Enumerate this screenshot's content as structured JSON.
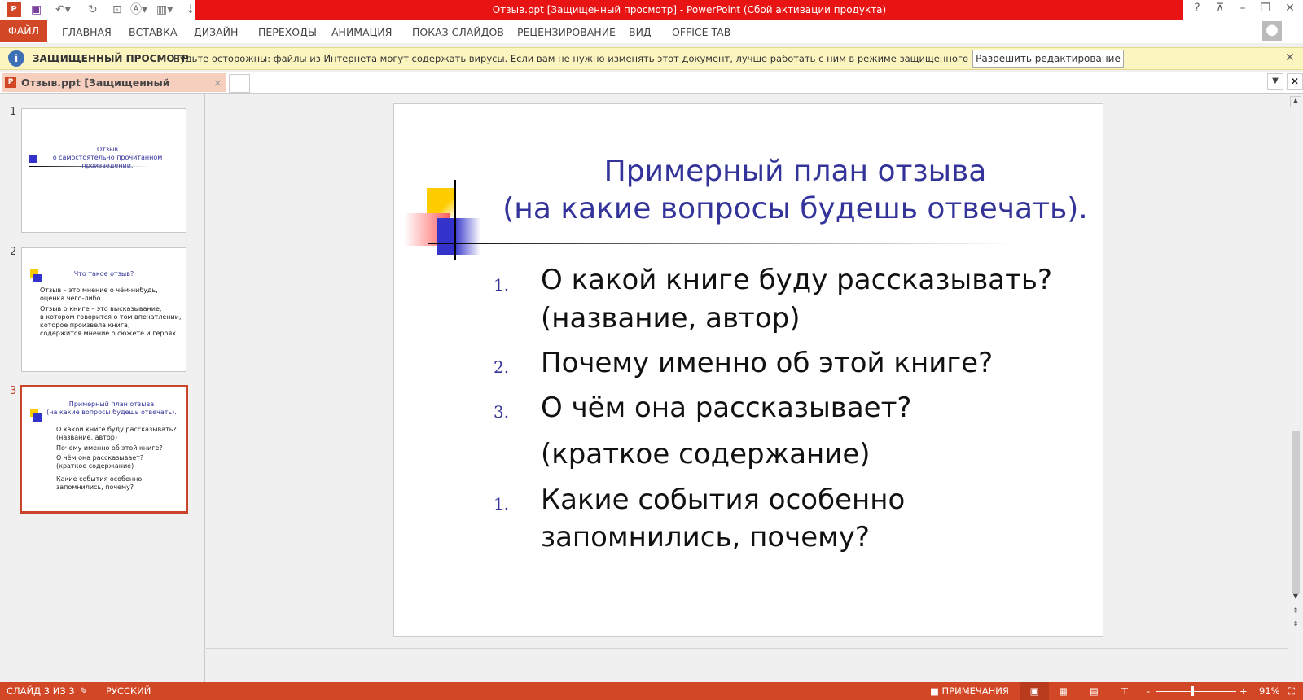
{
  "window": {
    "title": "Отзыв.ppt [Защищенный просмотр] -  PowerPoint (Сбой активации продукта)"
  },
  "ribbon": {
    "tabs": [
      "ФАЙЛ",
      "ГЛАВНАЯ",
      "ВСТАВКА",
      "ДИЗАЙН",
      "ПЕРЕХОДЫ",
      "АНИМАЦИЯ",
      "ПОКАЗ СЛАЙДОВ",
      "РЕЦЕНЗИРОВАНИЕ",
      "ВИД",
      "OFFICE TAB"
    ]
  },
  "warning": {
    "title": "ЗАЩИЩЕННЫЙ ПРОСМОТР",
    "message": "Будьте осторожны: файлы из Интернета могут содержать вирусы. Если вам не нужно изменять этот документ, лучше работать с ним в режиме защищенного просмотра.",
    "button": "Разрешить редактирование"
  },
  "doc_tab": {
    "label": "Отзыв.ppt [Защищенный просмотр]"
  },
  "thumbnails": [
    {
      "num": "1",
      "title": "Отзыв\nо самостоятельно прочитанном\nпроизведении."
    },
    {
      "num": "2",
      "title": "Что такое отзыв?",
      "items": [
        "Отзыв – это мнение о чём-нибудь, оценка чего-либо.",
        "Отзыв о книге – это высказывание,\nв котором говорится о том впечатлении, которое произвела книга;\nсодержится мнение о сюжете и героях."
      ]
    },
    {
      "num": "3",
      "title": "Примерный план отзыва\n(на какие вопросы будешь отвечать).",
      "items": [
        "О какой книге буду рассказывать? (название, автор)",
        "Почему именно об этой книге?",
        "О чём она рассказывает?\n(краткое содержание)",
        "Какие события особенно запомнились, почему?"
      ]
    }
  ],
  "slide": {
    "title_line1": "Примерный план отзыва",
    "title_line2": "(на какие вопросы будешь отвечать).",
    "items": [
      {
        "num": "1.",
        "lines": [
          "О какой книге буду рассказывать?",
          "(название, автор)"
        ]
      },
      {
        "num": "2.",
        "lines": [
          "Почему именно об этой книге?"
        ]
      },
      {
        "num": "3.",
        "lines": [
          "О чём она рассказывает?"
        ]
      },
      {
        "num": "",
        "lines": [
          "(краткое содержание)"
        ]
      },
      {
        "num": "1.",
        "lines": [
          "Какие события особенно",
          "запомнились, почему?"
        ]
      }
    ]
  },
  "status": {
    "slide": "СЛАЙД 3 ИЗ 3",
    "language": "РУССКИЙ",
    "notes": "ПРИМЕЧАНИЯ",
    "zoom": "91%",
    "zoom_minus": "-",
    "zoom_plus": "+"
  },
  "colors": {
    "accent": "#d24726",
    "title_red": "#e81414",
    "slide_title": "#333399"
  }
}
